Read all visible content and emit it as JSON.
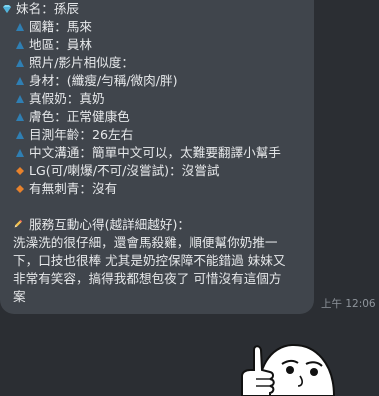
{
  "chat": {
    "profile_lines": [
      {
        "icon": "diamond-icon",
        "text": "妹名：孫辰"
      },
      {
        "icon": "triangle-icon",
        "text": "國籍：馬來"
      },
      {
        "icon": "triangle-icon",
        "text": "地區：員林"
      },
      {
        "icon": "triangle-icon",
        "text": "照片/影片相似度："
      },
      {
        "icon": "triangle-icon",
        "text": "身材：(纖瘦/勻稱/微肉/胖)"
      },
      {
        "icon": "triangle-icon",
        "text": "真假奶：真奶"
      },
      {
        "icon": "triangle-icon",
        "text": "膚色：正常健康色"
      },
      {
        "icon": "triangle-icon",
        "text": "目測年齡：26左右"
      },
      {
        "icon": "triangle-icon",
        "text": "中文溝通：簡單中文可以，太難要翻譯小幫手"
      },
      {
        "icon": "orange-diamond-icon",
        "text": "LG(可/喇爆/不可/沒嘗試)：沒嘗試"
      },
      {
        "icon": "orange-diamond-icon",
        "text": "有無刺青：沒有"
      }
    ],
    "review_heading": {
      "icon": "pencil-icon",
      "text": "服務互動心得(越詳細越好)："
    },
    "review_body": "洗澡洗的很仔細，還會馬殺雞，順便幫你奶推一\n下，口技也很棒 尤其是奶控保障不能錯過 妹妹又\n非常有笑容，搞得我都想包夜了 可惜沒有這個方\n案",
    "timestamp": "上午 12:06"
  },
  "colors": {
    "background": "#2b2e33",
    "bubble": "#40454c",
    "text": "#e6e8ea",
    "triangle_icon": "#2f7fb3",
    "orange_icon": "#e8822c",
    "diamond_icon": "#7fd4f0",
    "timestamp": "#8f959c"
  },
  "sticker": {
    "icon": "thumbs-up-meme-face-sticker"
  }
}
